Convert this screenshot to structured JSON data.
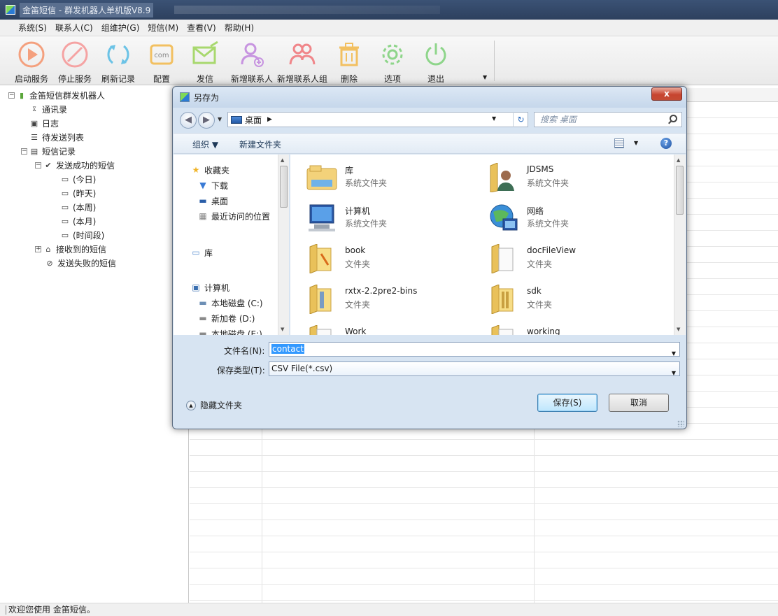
{
  "app": {
    "title": "金笛短信 - 群发机器人单机版V8.9"
  },
  "menu": [
    "系统(S)",
    "联系人(C)",
    "组维护(G)",
    "短信(M)",
    "查看(V)",
    "帮助(H)"
  ],
  "toolbar": {
    "start": "启动服务",
    "stop": "停止服务",
    "refresh": "刷新记录",
    "config": "配置",
    "config_icon_text": "com",
    "send": "发信",
    "add_contact": "新增联系人",
    "add_group": "新增联系人组",
    "delete": "删除",
    "options": "选项",
    "exit": "退出"
  },
  "tree": {
    "root": "金笛短信群发机器人",
    "contacts": "通讯录",
    "log": "日志",
    "queue": "待发送列表",
    "records": "短信记录",
    "sent_ok": "发送成功的短信",
    "today": "(今日)",
    "yesterday": "(昨天)",
    "this_week": "(本周)",
    "this_month": "(本月)",
    "period": "(时间段)",
    "received": "接收到的短信",
    "failed": "发送失败的短信"
  },
  "status": {
    "text": "欢迎您使用 金笛短信。"
  },
  "dialog": {
    "title": "另存为",
    "close": "x",
    "address": {
      "location": "桌面",
      "search_placeholder": "搜索 桌面"
    },
    "commands": {
      "organize": "组织 ▼",
      "new_folder": "新建文件夹"
    },
    "nav": {
      "favorites": "收藏夹",
      "downloads": "下载",
      "desktop": "桌面",
      "recent": "最近访问的位置",
      "libraries": "库",
      "computer": "计算机",
      "drive_c": "本地磁盘 (C:)",
      "drive_d": "新加卷 (D:)",
      "drive_e": "本地磁盘 (E:)"
    },
    "files": [
      {
        "name": "库",
        "type": "系统文件夹"
      },
      {
        "name": "JDSMS",
        "type": "系统文件夹"
      },
      {
        "name": "计算机",
        "type": "系统文件夹"
      },
      {
        "name": "网络",
        "type": "系统文件夹"
      },
      {
        "name": "book",
        "type": "文件夹"
      },
      {
        "name": "docFileView",
        "type": "文件夹"
      },
      {
        "name": "rxtx-2.2pre2-bins",
        "type": "文件夹"
      },
      {
        "name": "sdk",
        "type": "文件夹"
      },
      {
        "name": "Work",
        "type": ""
      },
      {
        "name": "working",
        "type": ""
      }
    ],
    "form": {
      "filename_label": "文件名(N):",
      "filename_value": "contact",
      "filetype_label": "保存类型(T):",
      "filetype_value": "CSV File(*.csv)",
      "hide_folders": "隐藏文件夹",
      "save": "保存(S)",
      "cancel": "取消"
    }
  }
}
